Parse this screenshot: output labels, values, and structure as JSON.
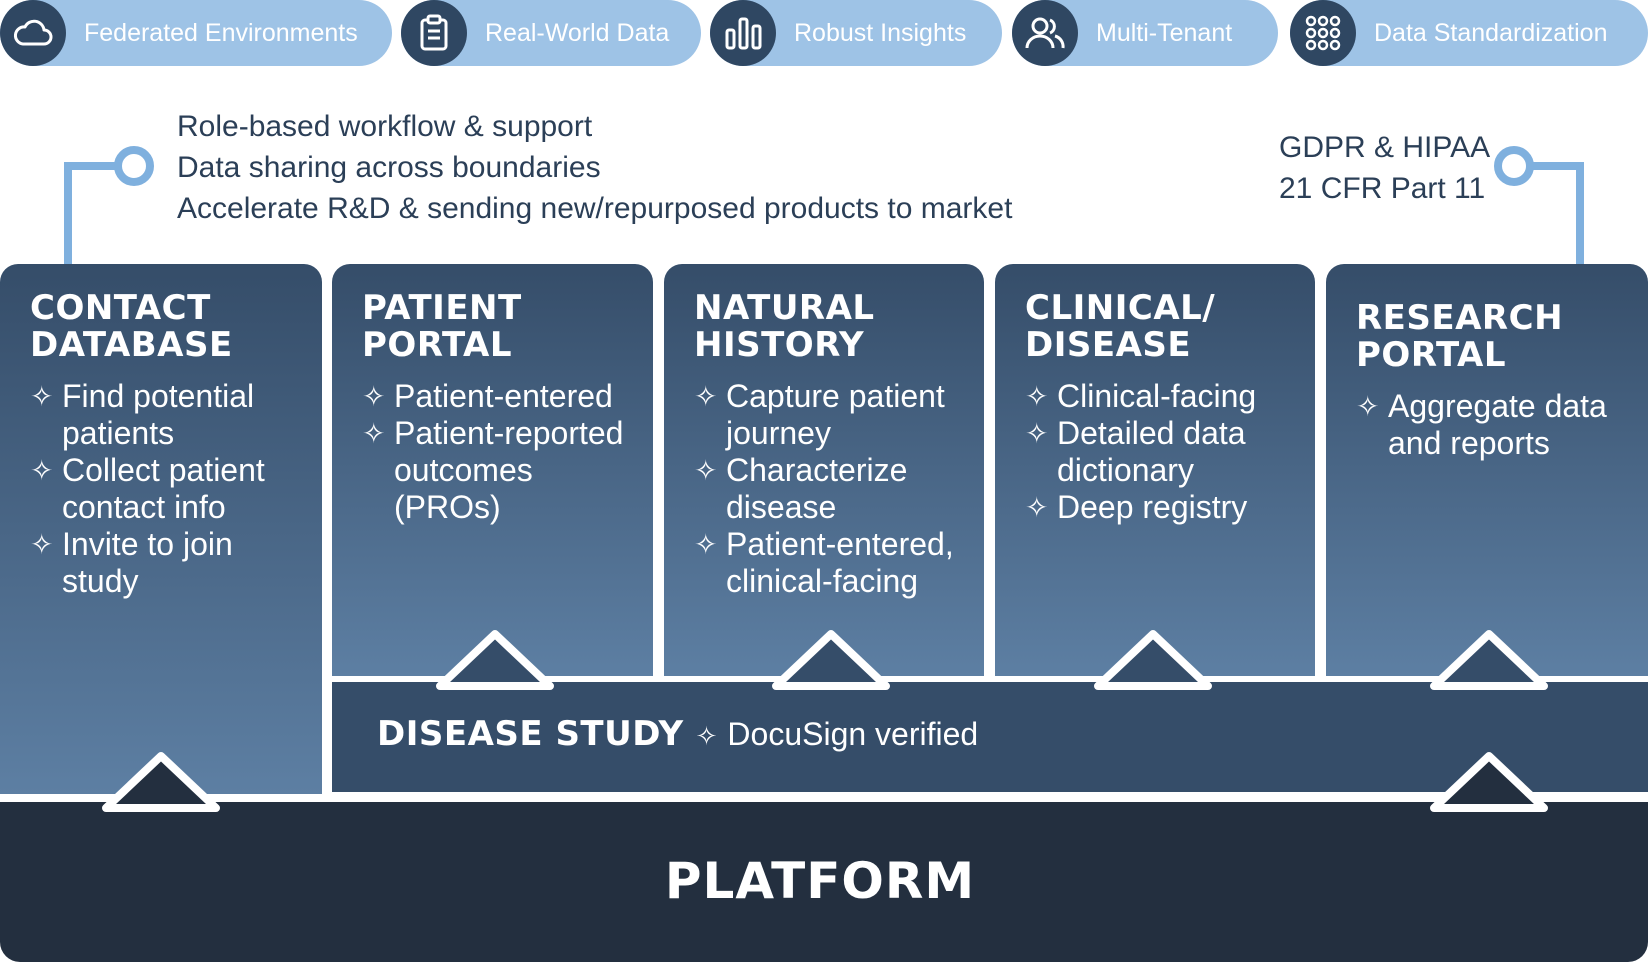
{
  "pills": [
    {
      "label": "Federated Environments",
      "icon": "cloud-icon"
    },
    {
      "label": "Real-World Data",
      "icon": "clipboard-icon"
    },
    {
      "label": "Robust Insights",
      "icon": "bar-chart-icon"
    },
    {
      "label": "Multi-Tenant",
      "icon": "users-icon"
    },
    {
      "label": "Data Standardization",
      "icon": "grid-icon"
    }
  ],
  "features": [
    "Role-based workflow & support",
    "Data sharing across boundaries",
    "Accelerate R&D & sending new/repurposed products to market"
  ],
  "compliance": [
    "GDPR & HIPAA",
    "21 CFR Part 11"
  ],
  "modules": [
    {
      "title": "CONTACT\nDATABASE",
      "items": [
        "Find potential\npatients",
        "Collect patient\ncontact info",
        "Invite to join\nstudy"
      ]
    },
    {
      "title": "PATIENT\nPORTAL",
      "items": [
        "Patient-entered",
        "Patient-reported\noutcomes\n(PROs)"
      ]
    },
    {
      "title": "NATURAL\nHISTORY",
      "items": [
        "Capture patient\njourney",
        "Characterize\ndisease",
        "Patient-entered,\nclinical-facing"
      ]
    },
    {
      "title": "CLINICAL/\nDISEASE",
      "items": [
        "Clinical-facing",
        "Detailed data\ndictionary",
        "Deep registry"
      ]
    },
    {
      "title": "RESEARCH\nPORTAL",
      "items": [
        "Aggregate data\nand reports"
      ]
    }
  ],
  "study": {
    "title": "DISEASE STUDY",
    "subtitle": "DocuSign verified"
  },
  "platform": {
    "title": "PLATFORM"
  },
  "colors": {
    "pill": "#9ec3e6",
    "icon_circle": "#2f4762",
    "module_top": "#354d69",
    "module_bottom": "#5d7fa3",
    "platform": "#232f3f",
    "connector": "#7fb0de"
  }
}
